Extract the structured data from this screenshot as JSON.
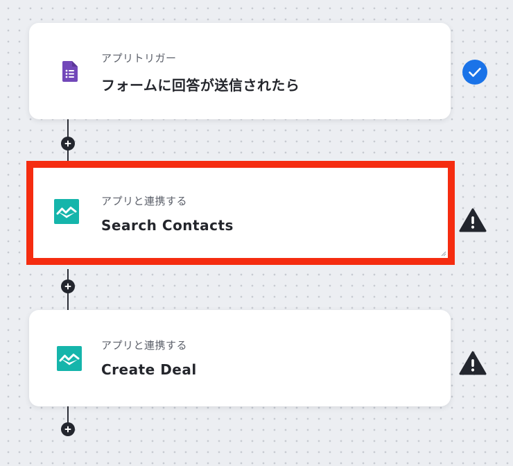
{
  "flow": {
    "steps": [
      {
        "subtitle": "アプリトリガー",
        "title": "フォームに回答が送信されたら",
        "icon": "google-forms-icon",
        "status": "complete"
      },
      {
        "subtitle": "アプリと連携する",
        "title": "Search Contacts",
        "icon": "app-integration-icon",
        "status": "warning",
        "selected": true
      },
      {
        "subtitle": "アプリと連携する",
        "title": "Create Deal",
        "icon": "app-integration-icon",
        "status": "warning"
      }
    ]
  },
  "colors": {
    "canvas_background": "#eceef2",
    "selection_border": "#f52c10",
    "check_blue": "#1a73e8",
    "forms_purple": "#7248b9",
    "integration_teal": "#15b5ab",
    "warning_dark": "#23262e"
  }
}
